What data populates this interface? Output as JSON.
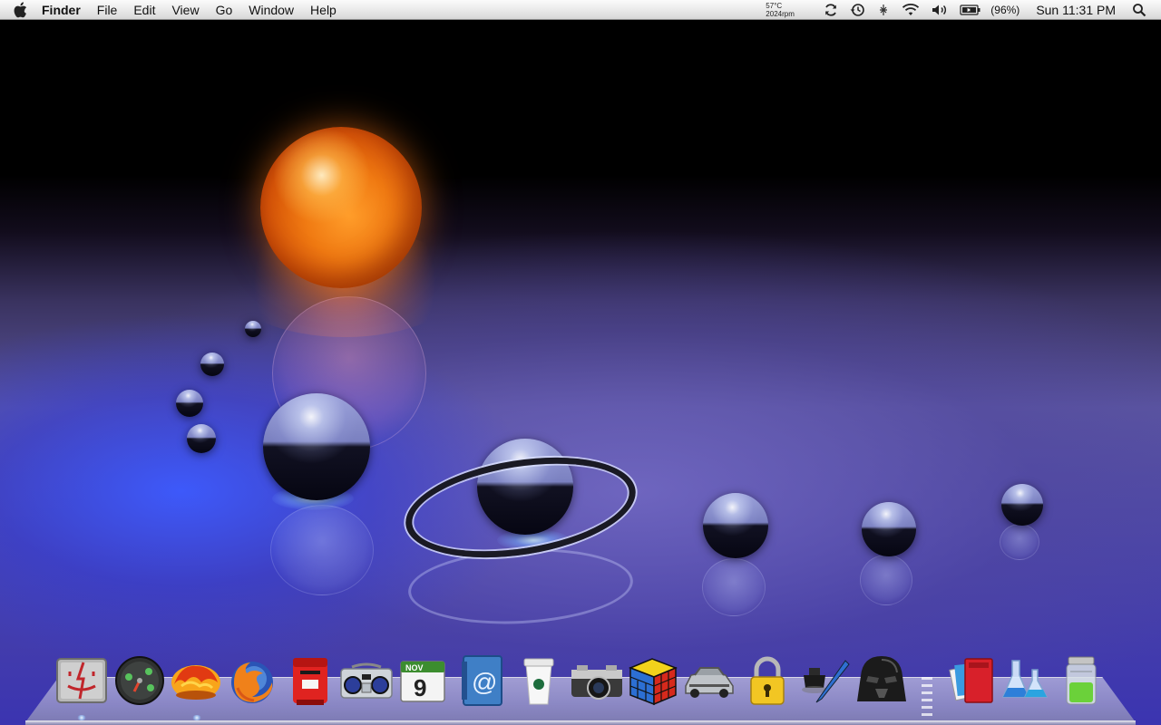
{
  "menubar": {
    "apple_icon": "apple-logo",
    "app_name": "Finder",
    "menus": [
      "File",
      "Edit",
      "View",
      "Go",
      "Window",
      "Help"
    ],
    "status": {
      "temperature": "57°C",
      "fan_speed": "2024rpm",
      "battery_percent": "(96%)",
      "clock": "Sun 11:31 PM",
      "icons": [
        "sync-icon",
        "time-machine-icon",
        "bluetooth-icon",
        "wifi-icon",
        "volume-icon",
        "battery-icon",
        "spotlight-icon"
      ]
    }
  },
  "dock": {
    "apps": [
      {
        "icon": "finder-icon"
      },
      {
        "icon": "dashboard-icon"
      },
      {
        "icon": "flame-helmet-icon"
      },
      {
        "icon": "firefox-icon"
      },
      {
        "icon": "postbox-mail-icon"
      },
      {
        "icon": "boombox-itunes-icon"
      },
      {
        "icon": "ical-icon",
        "month": "NOV",
        "day": "9"
      },
      {
        "icon": "address-book-icon",
        "symbol": "@"
      },
      {
        "icon": "coffee-cup-icon"
      },
      {
        "icon": "camera-icon"
      },
      {
        "icon": "rubiks-cube-icon"
      },
      {
        "icon": "delorean-icon"
      },
      {
        "icon": "padlock-icon"
      },
      {
        "icon": "ink-pen-icon"
      },
      {
        "icon": "darth-vader-icon"
      }
    ],
    "others": [
      {
        "icon": "red-folder-stack-icon"
      },
      {
        "icon": "flask-icon"
      },
      {
        "icon": "trash-icon"
      }
    ]
  }
}
